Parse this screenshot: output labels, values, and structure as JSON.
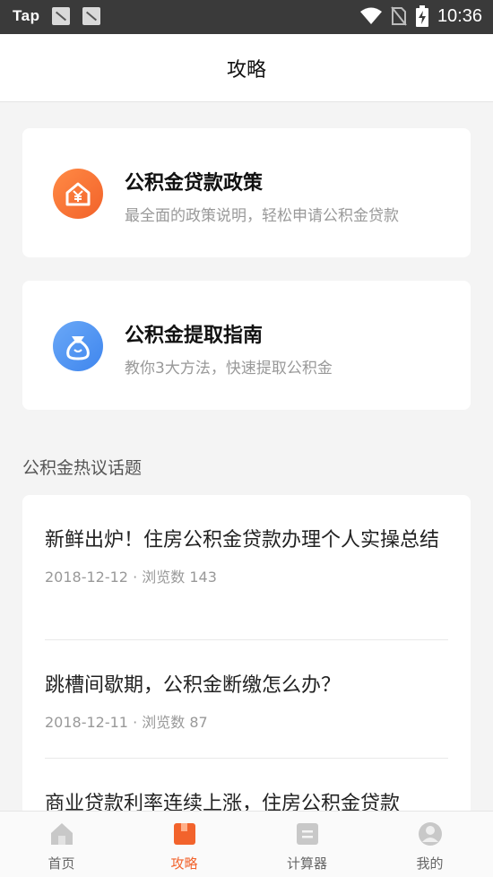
{
  "status_bar": {
    "carrier": "Tap",
    "time": "10:36",
    "icons": [
      "notification-icon",
      "notification-icon",
      "wifi-icon",
      "no-sim-icon",
      "battery-charging-icon"
    ]
  },
  "header": {
    "title": "攻略"
  },
  "features": [
    {
      "title": "公积金贷款政策",
      "subtitle": "最全面的政策说明，轻松申请公积金贷款",
      "icon": "house-yen-icon",
      "color": "#f2622a"
    },
    {
      "title": "公积金提取指南",
      "subtitle": "教你3大方法，快速提取公积金",
      "icon": "money-bag-icon",
      "color": "#3f86ee"
    }
  ],
  "section": {
    "title": "公积金热议话题"
  },
  "topics": [
    {
      "title": "新鲜出炉！住房公积金贷款办理个人实操总结",
      "meta": "2018-12-12 · 浏览数 143"
    },
    {
      "title": "跳槽间歇期，公积金断缴怎么办？",
      "meta": "2018-12-11 · 浏览数 87"
    },
    {
      "title": "商业贷款利率连续上涨，住房公积金贷款",
      "meta": ""
    }
  ],
  "tabbar": {
    "active_color": "#f2632c",
    "items": [
      {
        "label": "首页",
        "icon": "home-icon",
        "active": false
      },
      {
        "label": "攻略",
        "icon": "guide-book-icon",
        "active": true
      },
      {
        "label": "计算器",
        "icon": "calculator-icon",
        "active": false
      },
      {
        "label": "我的",
        "icon": "profile-icon",
        "active": false
      }
    ]
  }
}
